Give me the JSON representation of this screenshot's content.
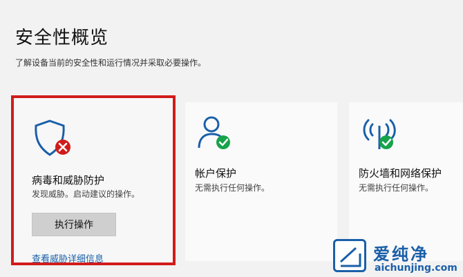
{
  "header": {
    "title": "安全性概览",
    "subtitle": "了解设备当前的安全性和运行情况并采取必要操作。"
  },
  "cards": [
    {
      "title": "病毒和威胁防护",
      "desc": "发现威胁。启动建议的操作。",
      "button_label": "执行操作",
      "link_label": "查看威胁详细信息",
      "icon": "shield-icon",
      "status": "error",
      "accent": "#d11b1b"
    },
    {
      "title": "帐户保护",
      "desc": "无需执行任何操作。",
      "icon": "person-icon",
      "status": "ok"
    },
    {
      "title": "防火墙和网络保护",
      "desc": "无需执行任何操作。",
      "icon": "wifi-antenna-icon",
      "status": "ok"
    }
  ],
  "watermark": {
    "text": "爱纯净",
    "url": "aichunjing.com"
  },
  "colors": {
    "icon_blue": "#1a5fa8",
    "ok_green": "#16a34a",
    "error_red": "#d11b1b",
    "highlight_border": "#d11b1b"
  }
}
